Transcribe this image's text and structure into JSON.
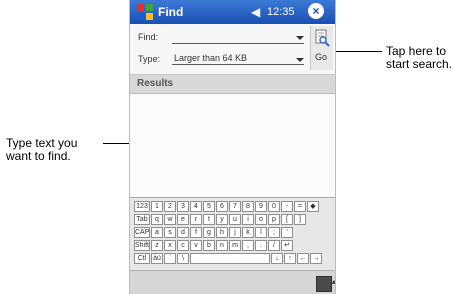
{
  "callouts": {
    "left": [
      "Type text you",
      "want to find."
    ],
    "right": [
      "Tap here to",
      "start search."
    ]
  },
  "titlebar": {
    "title": "Find",
    "time": "12:35",
    "close": "×",
    "speaker": "◀"
  },
  "form": {
    "find_label": "Find:",
    "find_value": "",
    "type_label": "Type:",
    "type_value": "Larger than 64 KB"
  },
  "go_button": {
    "label": "Go"
  },
  "results": {
    "label": "Results"
  },
  "keyboard": {
    "row1": [
      "123",
      "1",
      "2",
      "3",
      "4",
      "5",
      "6",
      "7",
      "8",
      "9",
      "0",
      "-",
      "=",
      "◆"
    ],
    "row2": [
      "Tab",
      "q",
      "w",
      "e",
      "r",
      "t",
      "y",
      "u",
      "i",
      "o",
      "p",
      "[",
      "]"
    ],
    "row3": [
      "CAP",
      "a",
      "s",
      "d",
      "f",
      "g",
      "h",
      "j",
      "k",
      "l",
      ";",
      "'"
    ],
    "row4": [
      "Shift",
      "z",
      "x",
      "c",
      "v",
      "b",
      "n",
      "m",
      ",",
      ".",
      "/",
      "↵"
    ],
    "row5": [
      "Ctl",
      "áü",
      "`",
      "\\",
      "",
      "↓",
      "↑",
      "←",
      "→"
    ]
  }
}
